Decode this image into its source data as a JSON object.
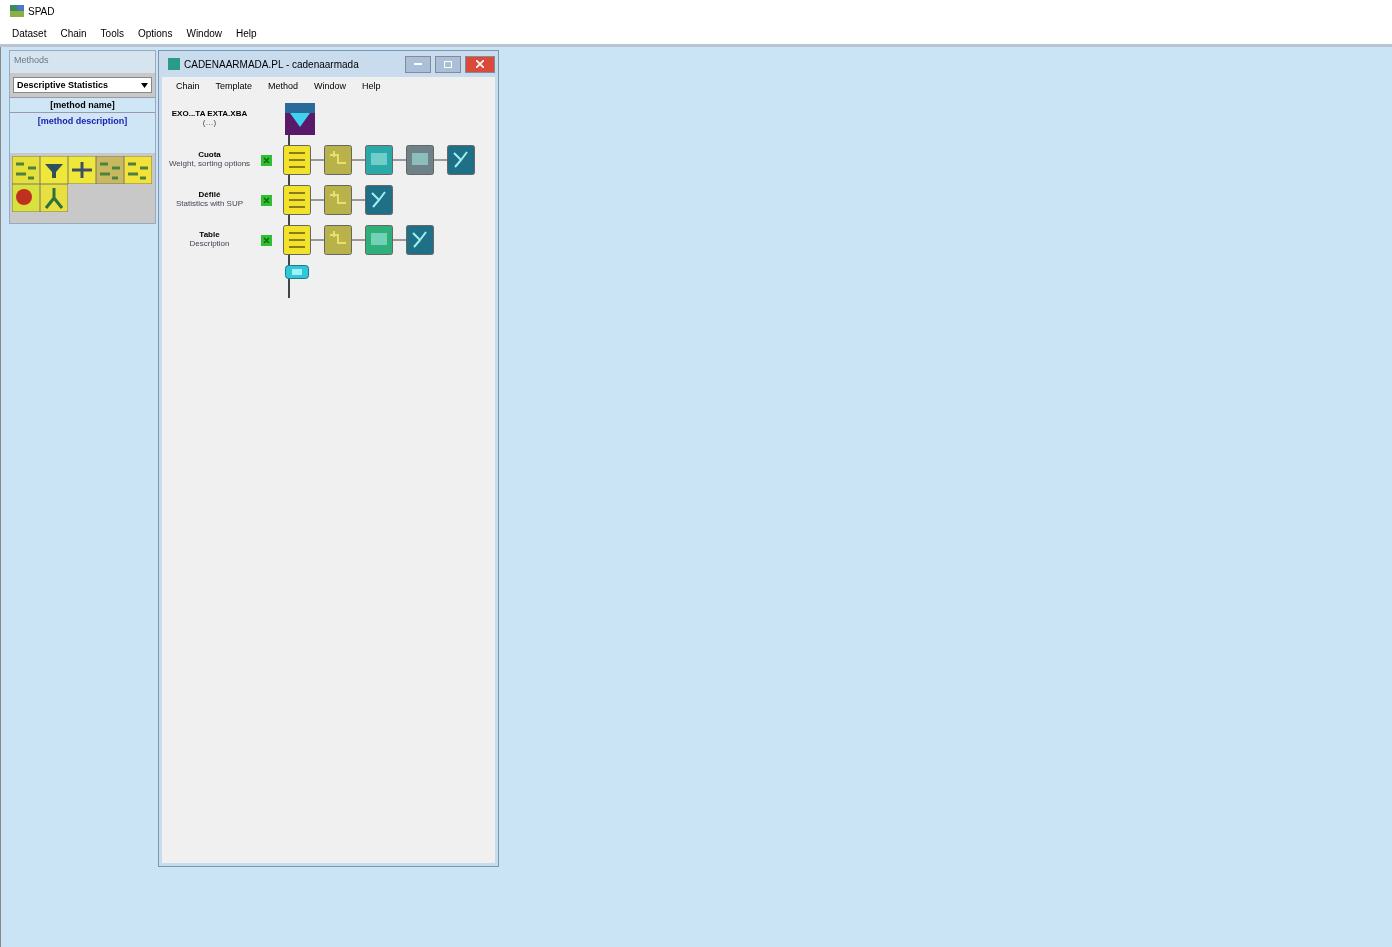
{
  "app": {
    "title": "SPAD",
    "menu": [
      "Dataset",
      "Chain",
      "Tools",
      "Options",
      "Window",
      "Help"
    ]
  },
  "methods_panel": {
    "title": "Methods",
    "category": "Descriptive Statistics",
    "method_name": "[method name]",
    "method_description": "[method description]",
    "tools": [
      {
        "kind": "chart"
      },
      {
        "kind": "funnel"
      },
      {
        "kind": "scale"
      },
      {
        "kind": "grid"
      },
      {
        "kind": "scatter"
      },
      {
        "kind": "ball"
      },
      {
        "kind": "tree"
      }
    ]
  },
  "chain_window": {
    "title": "CADENAARMADA.PL - cadenaarmada",
    "menu": [
      "Chain",
      "Template",
      "Method",
      "Window",
      "Help"
    ],
    "source": {
      "title": "EXO...TA EXTA.XBA",
      "subtitle": "(…)"
    },
    "rows": [
      {
        "title": "Cuota",
        "subtitle": "Weight, sorting options",
        "nodes": [
          {
            "kind": "method"
          },
          {
            "kind": "filter"
          },
          {
            "kind": "table"
          },
          {
            "kind": "report"
          },
          {
            "kind": "export"
          }
        ]
      },
      {
        "title": "Défilé",
        "subtitle": "Statistics with SUP",
        "nodes": [
          {
            "kind": "method"
          },
          {
            "kind": "filter"
          },
          {
            "kind": "export"
          }
        ]
      },
      {
        "title": "Table",
        "subtitle": "Description",
        "nodes": [
          {
            "kind": "method"
          },
          {
            "kind": "filter"
          },
          {
            "kind": "sheet"
          },
          {
            "kind": "export"
          }
        ]
      }
    ]
  }
}
